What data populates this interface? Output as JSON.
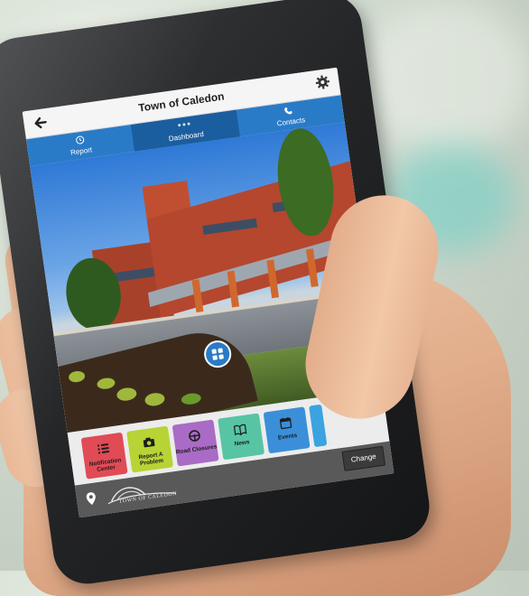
{
  "app": {
    "title": "Town of Caledon",
    "tabs": [
      {
        "label": "Report",
        "icon": "clock-icon"
      },
      {
        "label": "Dashboard",
        "icon": "dots-icon"
      },
      {
        "label": "Contacts",
        "icon": "phone-icon"
      }
    ],
    "active_tab": "Dashboard",
    "tiles": [
      {
        "label": "Notification Center",
        "color": "#e04b55",
        "icon": "list-icon"
      },
      {
        "label": "Report A Problem",
        "color": "#b7d335",
        "icon": "camera-icon"
      },
      {
        "label": "Road Closures",
        "color": "#a96bc5",
        "icon": "steering-wheel-icon"
      },
      {
        "label": "News",
        "color": "#57c4a4",
        "icon": "book-icon"
      },
      {
        "label": "Events",
        "color": "#3a8fd8",
        "icon": "calendar-icon"
      }
    ],
    "bottom": {
      "change_label": "Change",
      "logo_text": "TOWN OF CALEDON"
    }
  },
  "colors": {
    "accent": "#2a7bc7",
    "accent_dark": "#1b5e9f",
    "bottom_bar": "#595959"
  }
}
